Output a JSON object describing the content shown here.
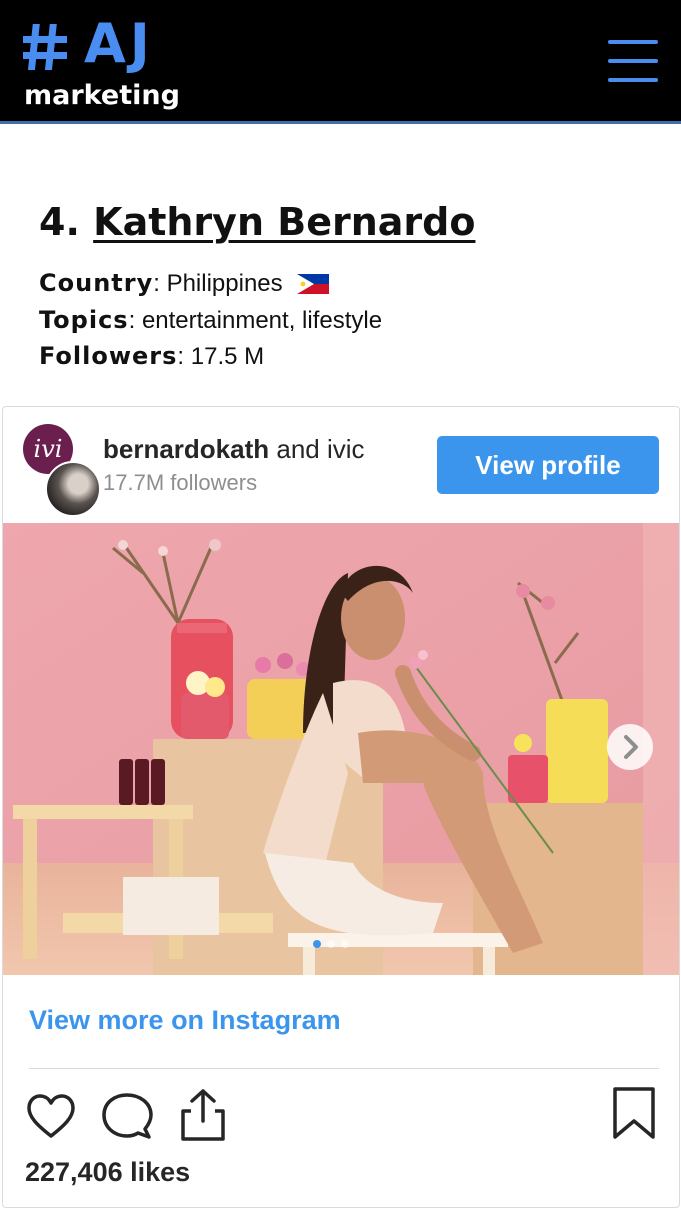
{
  "header": {
    "logo_mark": "#",
    "logo_letters": "AJ",
    "logo_sub": "marketing",
    "brand_color": "#4a8df0",
    "menu_icon": "hamburger-menu-icon"
  },
  "entry": {
    "number": "4.",
    "name": "Kathryn Bernardo",
    "country_label": "Country",
    "country": "Philippines",
    "flag_icon": "philippines-flag-icon",
    "topics_label": "Topics",
    "topics": "entertainment, lifestyle",
    "followers_label": "Followers",
    "followers": "17.5 M"
  },
  "instagram": {
    "owner_username": "bernardokath",
    "owner_rest": "and ivic",
    "follower_count": "17.7M followers",
    "view_profile": "View profile",
    "view_more": "View more on Instagram",
    "likes": "227,406 likes",
    "accent": "#3b95ed",
    "carousel_total": 3,
    "carousel_active": 1,
    "icons": [
      "heart-icon",
      "comment-icon",
      "share-icon",
      "bookmark-icon",
      "chevron-right-icon"
    ]
  }
}
